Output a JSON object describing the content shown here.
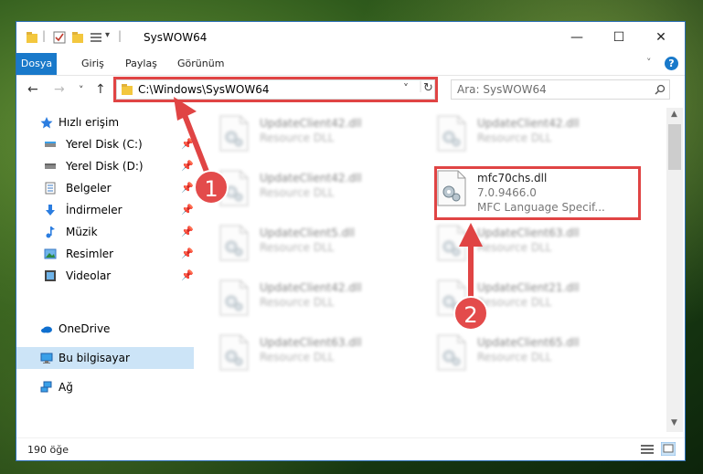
{
  "window": {
    "title": "SysWOW64",
    "controls": {
      "minimize": "—",
      "maximize": "☐",
      "close": "✕"
    }
  },
  "ribbon": {
    "tabs": [
      {
        "label": "Dosya",
        "active": true
      },
      {
        "label": "Giriş"
      },
      {
        "label": "Paylaş"
      },
      {
        "label": "Görünüm"
      }
    ],
    "help": "?"
  },
  "nav": {
    "back": "←",
    "forward": "→",
    "recent": "˅",
    "up": "↑",
    "address": "C:\\Windows\\SysWOW64",
    "address_dropdown": "˅",
    "refresh": "↻",
    "search_placeholder": "Ara: SysWOW64"
  },
  "sidebar": {
    "items": [
      {
        "label": "Hızlı erişim",
        "icon": "star-icon"
      },
      {
        "label": "Yerel Disk (C:)",
        "icon": "drive-icon",
        "pinned": true
      },
      {
        "label": "Yerel Disk (D:)",
        "icon": "drive-icon",
        "pinned": true
      },
      {
        "label": "Belgeler",
        "icon": "documents-icon",
        "pinned": true
      },
      {
        "label": "İndirmeler",
        "icon": "download-icon",
        "pinned": true
      },
      {
        "label": "Müzik",
        "icon": "music-icon",
        "pinned": true
      },
      {
        "label": "Resimler",
        "icon": "pictures-icon",
        "pinned": true
      },
      {
        "label": "Videolar",
        "icon": "videos-icon",
        "pinned": true
      },
      {
        "label": "OneDrive",
        "icon": "cloud-icon"
      },
      {
        "label": "Bu bilgisayar",
        "icon": "computer-icon",
        "selected": true
      },
      {
        "label": "Ağ",
        "icon": "network-icon"
      }
    ]
  },
  "files": [
    {
      "name": "UpdateClient42.dll",
      "type": "Resource DLL",
      "blurred": true
    },
    {
      "name": "UpdateClient42.dll",
      "type": "Resource DLL",
      "blurred": true
    },
    {
      "name": "UpdateClient42.dll",
      "type": "Resource DLL",
      "blurred": true
    },
    {
      "name": "mfc70chs.dll",
      "version": "7.0.9466.0",
      "type": "MFC Language Specif...",
      "blurred": false
    },
    {
      "name": "UpdateClient5.dll",
      "type": "Resource DLL",
      "blurred": true
    },
    {
      "name": "UpdateClient63.dll",
      "type": "Resource DLL",
      "blurred": true
    },
    {
      "name": "UpdateClient42.dll",
      "type": "Resource DLL",
      "blurred": true
    },
    {
      "name": "UpdateClient21.dll",
      "type": "Resource DLL",
      "blurred": true
    },
    {
      "name": "UpdateClient63.dll",
      "type": "Resource DLL",
      "blurred": true
    },
    {
      "name": "UpdateClient65.dll",
      "type": "Resource DLL",
      "blurred": true
    }
  ],
  "status": {
    "item_count": "190 öğe"
  },
  "annotations": {
    "step1": "1",
    "step2": "2",
    "color": "#e04444"
  }
}
